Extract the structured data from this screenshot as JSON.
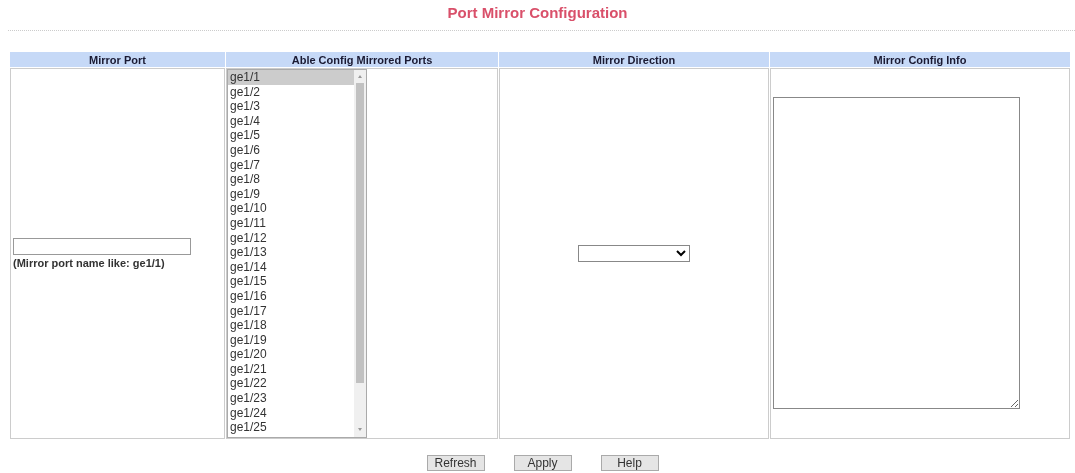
{
  "title": "Port Mirror Configuration",
  "table": {
    "columns": [
      "Mirror Port",
      "Able Config Mirrored Ports",
      "Mirror Direction",
      "Mirror Config Info"
    ]
  },
  "mirror_port": {
    "hint": "(Mirror port name like: ge1/1)"
  },
  "mirrored_ports": [
    {
      "label": "ge1/1",
      "selected": true
    },
    {
      "label": "ge1/2",
      "selected": false
    },
    {
      "label": "ge1/3",
      "selected": false
    },
    {
      "label": "ge1/4",
      "selected": false
    },
    {
      "label": "ge1/5",
      "selected": false
    },
    {
      "label": "ge1/6",
      "selected": false
    },
    {
      "label": "ge1/7",
      "selected": false
    },
    {
      "label": "ge1/8",
      "selected": false
    },
    {
      "label": "ge1/9",
      "selected": false
    },
    {
      "label": "ge1/10",
      "selected": false
    },
    {
      "label": "ge1/11",
      "selected": false
    },
    {
      "label": "ge1/12",
      "selected": false
    },
    {
      "label": "ge1/13",
      "selected": false
    },
    {
      "label": "ge1/14",
      "selected": false
    },
    {
      "label": "ge1/15",
      "selected": false
    },
    {
      "label": "ge1/16",
      "selected": false
    },
    {
      "label": "ge1/17",
      "selected": false
    },
    {
      "label": "ge1/18",
      "selected": false
    },
    {
      "label": "ge1/19",
      "selected": false
    },
    {
      "label": "ge1/20",
      "selected": false
    },
    {
      "label": "ge1/21",
      "selected": false
    },
    {
      "label": "ge1/22",
      "selected": false
    },
    {
      "label": "ge1/23",
      "selected": false
    },
    {
      "label": "ge1/24",
      "selected": false
    },
    {
      "label": "ge1/25",
      "selected": false
    }
  ],
  "buttons": [
    "Refresh",
    "Apply",
    "Help"
  ]
}
